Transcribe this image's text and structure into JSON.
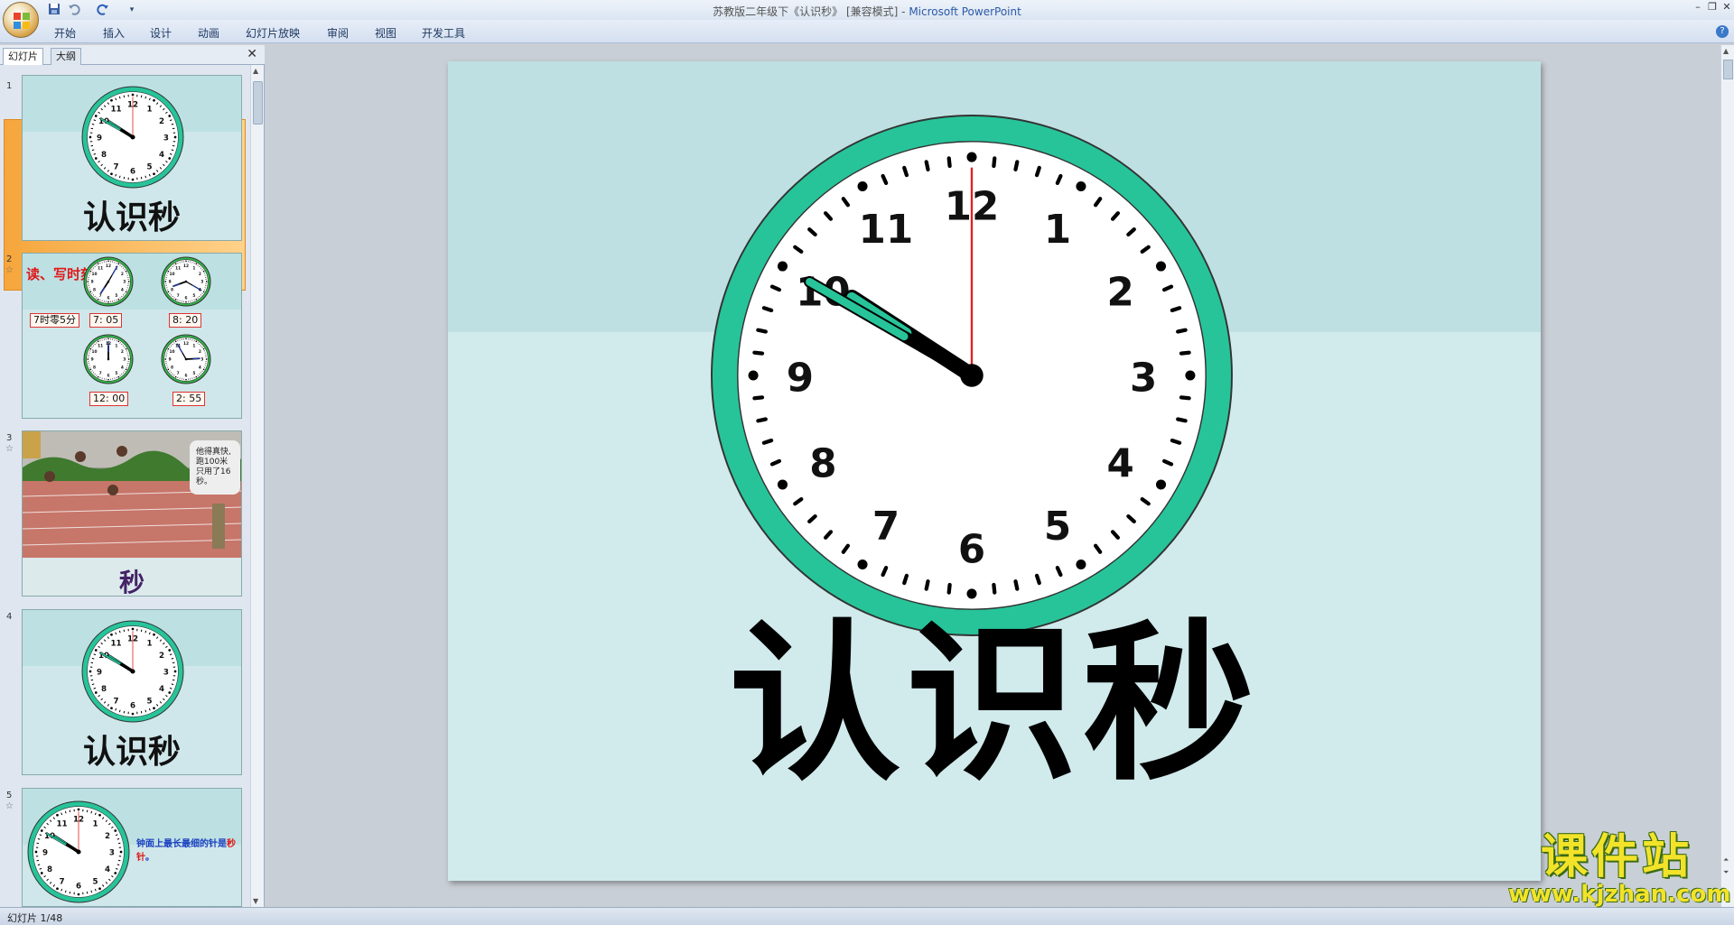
{
  "window": {
    "title": "苏教版二年级下《认识秒》 [兼容模式]",
    "app_name": "Microsoft PowerPoint",
    "title_separator": " - "
  },
  "quick_access": [
    {
      "icon": "save-icon"
    },
    {
      "icon": "undo-icon"
    },
    {
      "icon": "redo-icon"
    },
    {
      "icon": "customize-icon"
    }
  ],
  "menu": [
    "开始",
    "插入",
    "设计",
    "动画",
    "幻灯片放映",
    "审阅",
    "视图",
    "开发工具"
  ],
  "pane": {
    "tabs": [
      "幻灯片",
      "大纲"
    ],
    "close": "✕"
  },
  "thumbnails": [
    {
      "num": "1",
      "title": "认识秒",
      "selected": true
    },
    {
      "num": "2",
      "heading": "读、写时刻",
      "labels": [
        "7时零5分",
        "7: 05",
        "8: 20",
        "12: 00",
        "2: 55"
      ]
    },
    {
      "num": "3",
      "caption": "秒",
      "speech": "他得真快, 跑100米只用了16秒。"
    },
    {
      "num": "4",
      "title": "认识秒"
    },
    {
      "num": "5",
      "note_a": "钟面上最长最细的针是",
      "note_b": "秒针",
      "note_c": "。"
    }
  ],
  "slide": {
    "title": "认识秒",
    "clock": {
      "numbers": [
        "12",
        "1",
        "2",
        "3",
        "4",
        "5",
        "6",
        "7",
        "8",
        "9",
        "10",
        "11"
      ],
      "hour_hand_value": 10.1,
      "minute_hand_value": 10,
      "second_hand_value": 0,
      "ring_color": "#27c49a",
      "second_hand_color": "#e02020"
    }
  },
  "status": {
    "slide_counter": "幻灯片 1/48"
  },
  "watermark": {
    "cn": "课件站",
    "url": "www.kjzhan.com"
  }
}
